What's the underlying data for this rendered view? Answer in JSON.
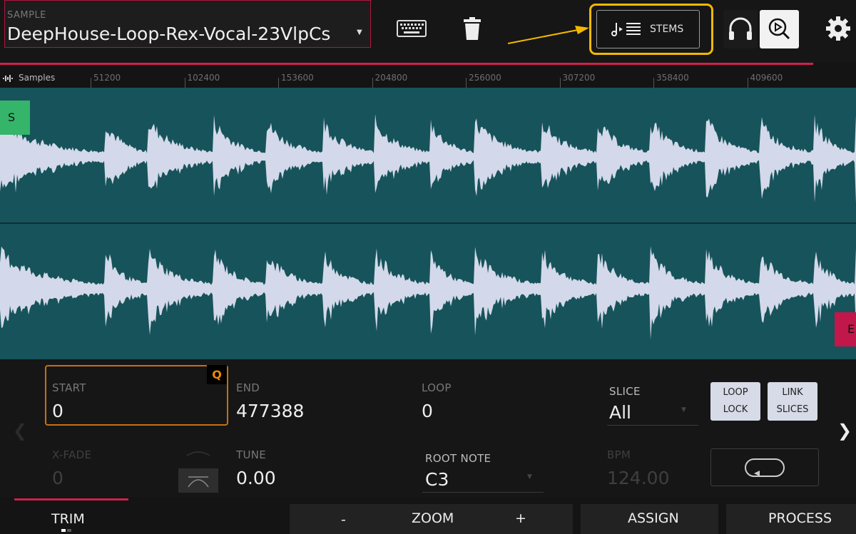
{
  "header": {
    "sample_label": "SAMPLE",
    "sample_name": "DeepHouse-Loop-Rex-Vocal-23VlpCs",
    "stems_label": "STEMS"
  },
  "ruler": {
    "title": "Samples",
    "ticks": [
      "51200",
      "102400",
      "153600",
      "204800",
      "256000",
      "307200",
      "358400",
      "409600"
    ]
  },
  "markers": {
    "start": "S",
    "end": "E"
  },
  "params": {
    "start": {
      "label": "START",
      "value": "0",
      "quantize_badge": "Q"
    },
    "end": {
      "label": "END",
      "value": "477388"
    },
    "loop": {
      "label": "LOOP",
      "value": "0"
    },
    "slice": {
      "label": "SLICE",
      "value": "All"
    },
    "loop_lock": {
      "line1": "LOOP",
      "line2": "LOCK"
    },
    "link_slices": {
      "line1": "LINK",
      "line2": "SLICES"
    },
    "xfade": {
      "label": "X-FADE",
      "value": "0"
    },
    "tune": {
      "label": "TUNE",
      "value": "0.00"
    },
    "root_note": {
      "label": "ROOT NOTE",
      "value": "C3"
    },
    "bpm": {
      "label": "BPM",
      "value": "124.00"
    }
  },
  "bottom": {
    "trim": "TRIM",
    "zoom_minus": "-",
    "zoom": "ZOOM",
    "zoom_plus": "+",
    "assign": "ASSIGN",
    "process": "PROCESS"
  },
  "colors": {
    "accent_red": "#d0204a",
    "highlight_yellow": "#f5b800",
    "start_orange": "#c96f10",
    "waveform_bg": "#17535a",
    "waveform_fill": "#d3d9ea",
    "start_marker": "#34b56a",
    "end_marker": "#c2174a"
  },
  "icons": [
    "keyboard-icon",
    "trash-icon",
    "stems-icon",
    "arrow-annotation",
    "headphones-icon",
    "zoom-play-icon",
    "gear-icon",
    "waveform-icon",
    "crossfade-curve-icon",
    "loop-icon",
    "chevron-right-icon",
    "chevron-left-icon"
  ]
}
